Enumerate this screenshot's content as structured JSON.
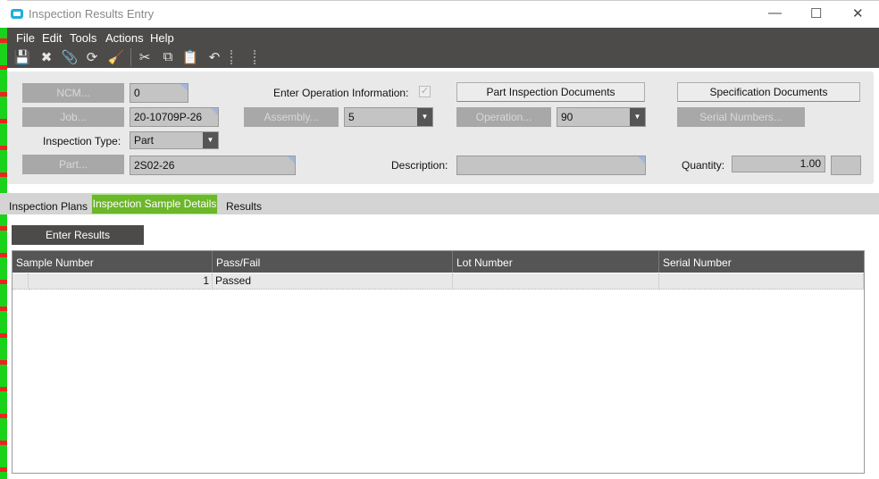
{
  "window": {
    "title": "Inspection Results Entry",
    "minimize": "—",
    "maximize": "☐",
    "close": "✕"
  },
  "menu": [
    "File",
    "Edit",
    "Tools",
    "Actions",
    "Help"
  ],
  "toolbar": {
    "save": "💾",
    "delete": "✖",
    "attach": "📎",
    "refresh": "⟳",
    "clear": "🧹",
    "cut": "✂",
    "copy": "⧉",
    "paste": "📋",
    "undo": "↶"
  },
  "form": {
    "ncm_button": "NCM...",
    "ncm_value": "0",
    "job_button": "Job...",
    "job_value": "20-10709P-26",
    "assembly_button": "Assembly...",
    "assembly_value": "5",
    "inspection_type_label": "Inspection Type:",
    "inspection_type_value": "Part",
    "part_button": "Part...",
    "part_value": "2S02-26",
    "enter_op_label": "Enter Operation Information:",
    "enter_op_checked": true,
    "part_docs_button": "Part Inspection Documents",
    "spec_docs_button": "Specification Documents",
    "operation_button": "Operation...",
    "operation_value": "90",
    "serial_button": "Serial Numbers...",
    "description_label": "Description:",
    "description_value": "",
    "quantity_label": "Quantity:",
    "quantity_value": "1.00",
    "uom_value": ""
  },
  "tabs": [
    "Inspection Plans",
    "Inspection Sample Details",
    "Results"
  ],
  "active_tab": "Inspection Sample Details",
  "enter_results_button": "Enter Results",
  "grid": {
    "columns": [
      "Sample Number",
      "Pass/Fail",
      "Lot Number",
      "Serial Number"
    ],
    "rows": [
      {
        "sample": "1",
        "pass_fail": "Passed",
        "lot": "",
        "serial": ""
      }
    ]
  },
  "colors": {
    "accent": "#6cb72a",
    "dark": "#4d4b4a"
  }
}
